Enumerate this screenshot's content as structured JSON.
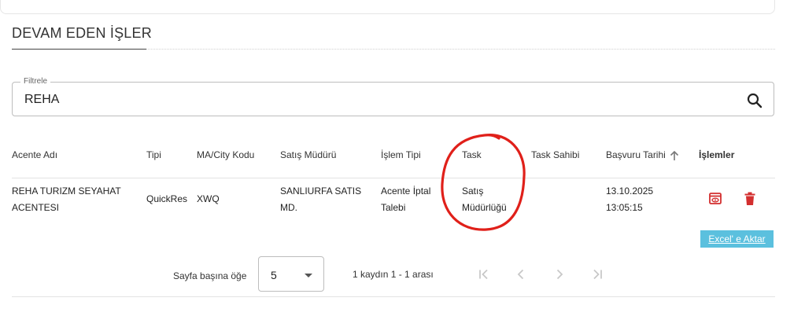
{
  "section": {
    "title": "DEVAM EDEN İŞLER"
  },
  "filter": {
    "label": "Filtrele",
    "value": "REHA"
  },
  "table": {
    "headers": {
      "agency": "Acente Adı",
      "type": "Tipi",
      "ma_city": "MA/City Kodu",
      "sales_manager": "Satış Müdürü",
      "transaction_type": "İşlem Tipi",
      "task": "Task",
      "task_owner": "Task Sahibi",
      "application_date": "Başvuru Tarihi",
      "actions": "İşlemler"
    },
    "rows": [
      {
        "agency_line1": "REHA TURIZM SEYAHAT",
        "agency_line2": "ACENTESI",
        "type": "QuickRes",
        "ma_city": "XWQ",
        "sales_manager_line1": "SANLIURFA SATIS",
        "sales_manager_line2": "MD.",
        "transaction_type_line1": "Acente İptal",
        "transaction_type_line2": "Talebi",
        "task_line1": "Satış",
        "task_line2": "Müdürlüğü",
        "task_owner": "",
        "date": "13.10.2025",
        "time": "13:05:15"
      }
    ]
  },
  "toolbar": {
    "excel_label": "Excel' e Aktar"
  },
  "pagination": {
    "rows_per_page_label": "Sayfa başına öğe",
    "page_size": "5",
    "range_label": "1 kaydın 1 - 1 arası"
  },
  "icons": {
    "search": "search-icon",
    "sort": "arrow-up-icon",
    "view": "view-icon",
    "delete": "trash-icon",
    "first": "first-page-icon",
    "prev": "chevron-left-icon",
    "next": "chevron-right-icon",
    "last": "last-page-icon"
  },
  "colors": {
    "action_red": "#d32f2f",
    "excel_button": "#5bc0de",
    "annotation_red": "#e0201a"
  }
}
